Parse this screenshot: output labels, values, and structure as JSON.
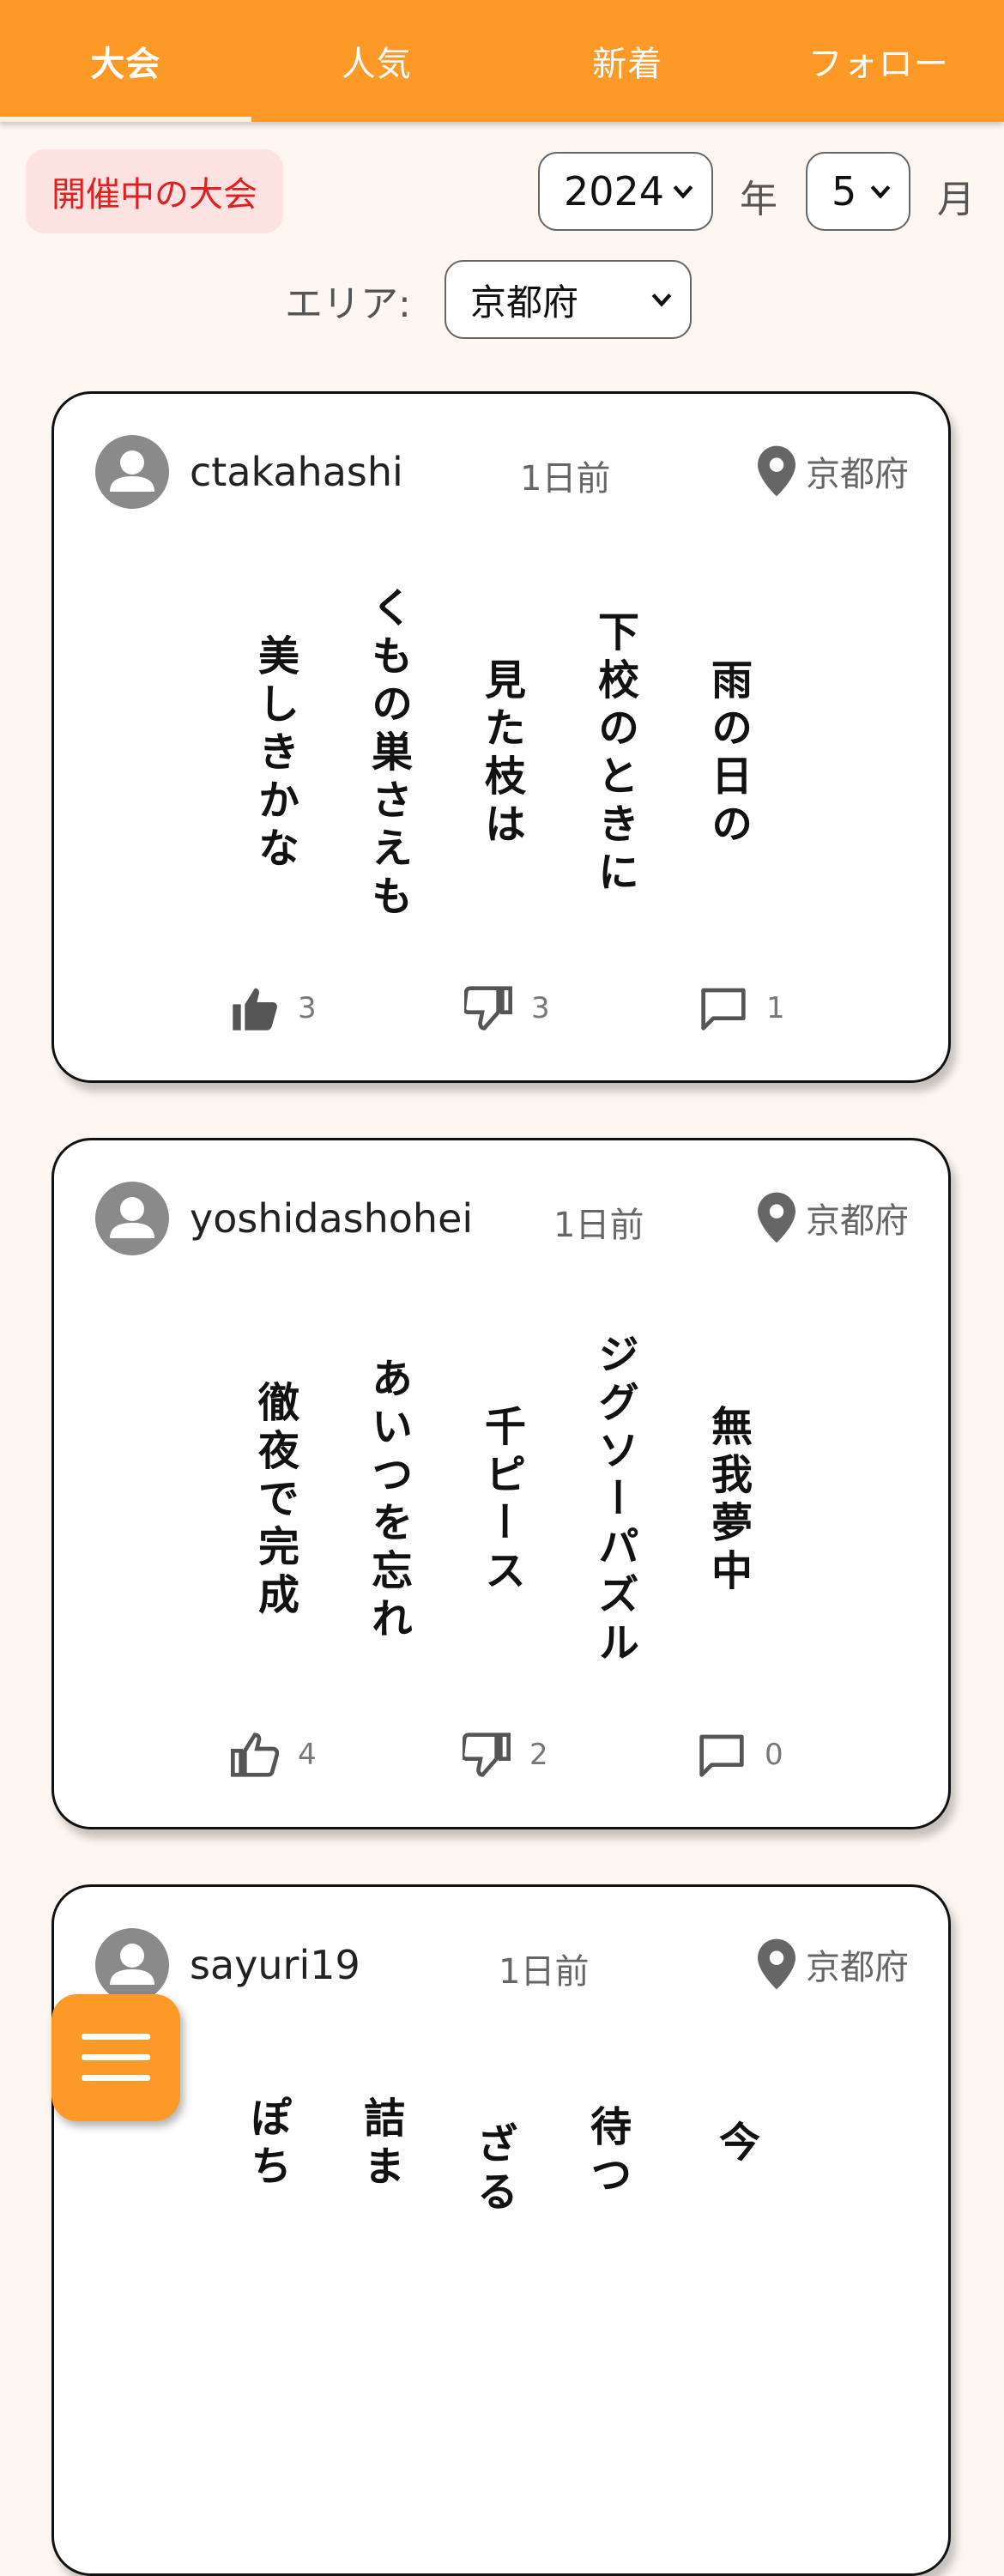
{
  "tabs": [
    {
      "label": "大会",
      "active": true
    },
    {
      "label": "人気",
      "active": false
    },
    {
      "label": "新着",
      "active": false
    },
    {
      "label": "フォロー",
      "active": false
    }
  ],
  "filters": {
    "badge": "開催中の大会",
    "year": "2024",
    "year_unit": "年",
    "month": "5",
    "month_unit": "月",
    "area_label": "エリア:",
    "area": "京都府"
  },
  "posts": [
    {
      "username": "ctakahashi",
      "time": "1日前",
      "location": "京都府",
      "poem": [
        "雨の日の",
        "下校のときに",
        "見た枝は",
        "くもの巣さえも",
        "美しきかな"
      ],
      "likes": "3",
      "dislikes": "3",
      "comments": "1"
    },
    {
      "username": "yoshidashohei",
      "time": "1日前",
      "location": "京都府",
      "poem": [
        "無我夢中",
        "ジグソーパズル",
        "千ピース",
        "あいつを忘れ",
        "徹夜で完成"
      ],
      "likes": "4",
      "dislikes": "2",
      "comments": "0"
    },
    {
      "username": "sayuri19",
      "time": "1日前",
      "location": "京都府",
      "poem": [
        "今",
        "待つ",
        "ざる",
        "詰ま",
        "ぽち"
      ]
    }
  ],
  "colors": {
    "accent": "#fd9927",
    "badge_bg": "#fde2e2",
    "badge_text": "#e02020",
    "background": "#fdf6f1"
  },
  "icons": {
    "avatar": "person-icon",
    "location": "map-pin-icon",
    "like": "thumbs-up-icon",
    "dislike": "thumbs-down-icon",
    "comment": "comment-icon",
    "menu": "hamburger-menu-icon"
  }
}
